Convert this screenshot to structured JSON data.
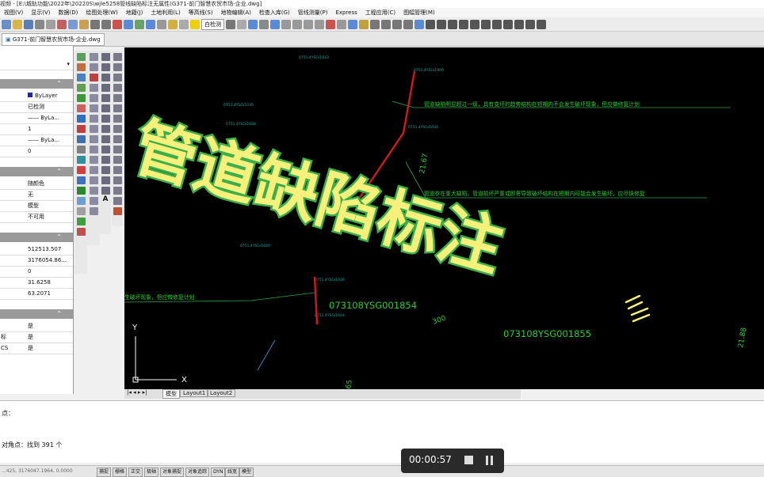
{
  "window": {
    "title": "视频 - [E:\\城轨功能\\2022年\\20220S\\wjle5258管线缺陷标注无属性(G371-前门智慧农贸市场-企业.dwg]"
  },
  "menu": [
    "视图(V)",
    "显示(V)",
    "数据(D)",
    "绘图处理(W)",
    "地籍(J)",
    "土地利用(L)",
    "等高线(S)",
    "地物编辑(A)",
    "检查入库(G)",
    "管线测量(P)",
    "Express",
    "工程应用(C)",
    "图幅管理(M)"
  ],
  "toolbar": {
    "layer_select": "白检测"
  },
  "document_tab": "G371-前门智慧农贸市场-企业.dwg",
  "properties": {
    "sections": [
      {
        "rows": [
          {
            "key": "",
            "value": "ByLayer"
          },
          {
            "key": "",
            "value": "已检测"
          },
          {
            "key": "",
            "value": "—— ByLa..."
          },
          {
            "key": "",
            "value": "1"
          },
          {
            "key": "",
            "value": "—— ByLa..."
          },
          {
            "key": "",
            "value": "0"
          }
        ]
      },
      {
        "rows": [
          {
            "key": "",
            "value": "随颜色"
          },
          {
            "key": "",
            "value": "无"
          },
          {
            "key": "",
            "value": "模型"
          },
          {
            "key": "",
            "value": "不可用"
          }
        ]
      },
      {
        "rows": [
          {
            "key": "",
            "value": "512513.507"
          },
          {
            "key": "",
            "value": "3176054.86..."
          },
          {
            "key": "",
            "value": "0"
          },
          {
            "key": "",
            "value": "31.6258"
          },
          {
            "key": "",
            "value": "63.2071"
          }
        ]
      },
      {
        "rows": [
          {
            "key": "",
            "value": "是"
          },
          {
            "key": "标",
            "value": "是"
          },
          {
            "key": "CS",
            "value": "是"
          }
        ]
      }
    ]
  },
  "drawing": {
    "annotation_1": "管道缺陷明显超过一级，具有变坏的趋势结构在短期内不会发生破坏现象，但应做修复计划",
    "annotation_2": "管道存在重大缺陷，管道损坏严重或即将导致破坏结构在短期内可能会发生破坏，应尽快修复",
    "annotation_3": "生破坏现象，但应做修复计划",
    "pipe_id_1": "073108YSG001854",
    "pipe_id_2": "073108YSG001855",
    "value_2167": "21.67",
    "value_2188": "21.88",
    "value_300": "300",
    "value_65": "65",
    "small_labels": [
      "0751.4YSG/1023",
      "0751.4YSG/1009",
      "0751.4YSG/1035",
      "0751.4YSG/1038",
      "0751.4YSG/1034",
      "0751.4YSG/1040",
      "0751.4YSG/1036",
      "0751.4YSG/1024"
    ],
    "overlay_title": "管道缺陷标注",
    "axis_y": "Y",
    "axis_x": "X"
  },
  "layout_tabs": [
    "模型",
    "Layout1",
    "Layout2"
  ],
  "command_line": {
    "line1": "点：",
    "line2": "对角点：找到 391 个"
  },
  "status": {
    "coords": "...425, 3176047.1964, 0.0000",
    "buttons": [
      "捕捉",
      "栅格",
      "正交",
      "极轴",
      "对象捕捉",
      "对象追踪",
      "DYN",
      "线宽",
      "模型"
    ]
  },
  "player": {
    "time": "00:00:57"
  },
  "colors": {
    "canvas_bg": "#000000",
    "annotation_green": "#2ecc2e",
    "pipe_red": "#d21a1a",
    "overlay_fill": "#f7f07a",
    "overlay_stroke": "#3bb04a"
  }
}
